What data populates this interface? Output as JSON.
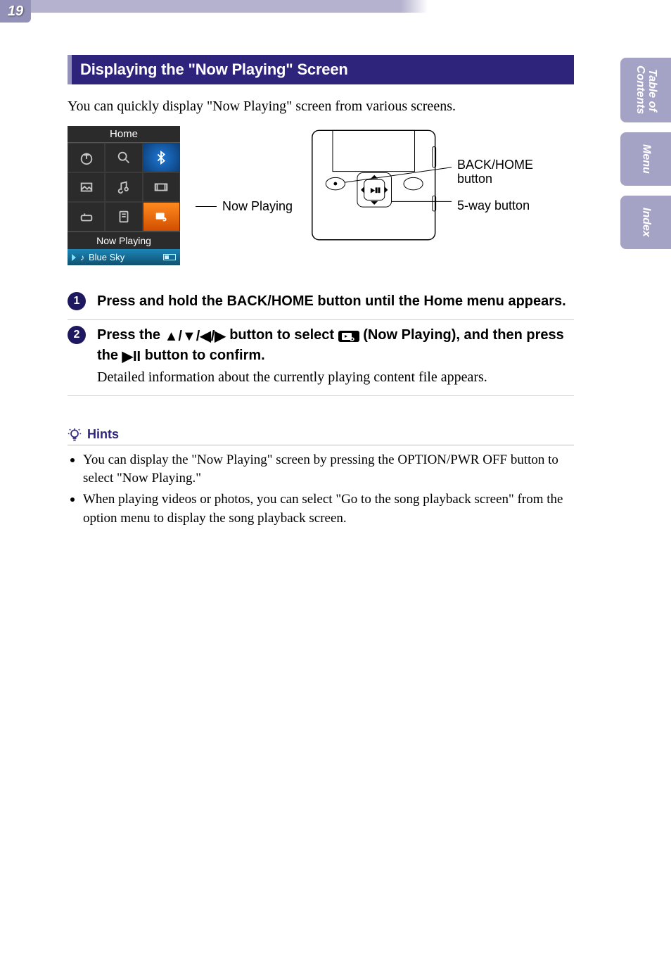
{
  "page_number": "19",
  "side_nav": {
    "toc": "Table of\nContents",
    "menu": "Menu",
    "index": "Index"
  },
  "section_title": "Displaying the \"Now Playing\" Screen",
  "intro": "You can quickly display \"Now Playing\" screen from various screens.",
  "home_screen": {
    "title": "Home",
    "selected_label": "Now Playing",
    "song_name": "Blue Sky",
    "icons": [
      "share-icon",
      "search-icon",
      "bluetooth-icon",
      "photo-icon",
      "music-icon",
      "video-icon",
      "settings-icon",
      "playlist-icon",
      "now-playing-icon"
    ]
  },
  "callouts": {
    "now_playing": "Now Playing",
    "back_home": "BACK/HOME button",
    "five_way": "5-way button"
  },
  "steps": [
    {
      "num": "1",
      "title_pre": "Press and hold the BACK/HOME button until the Home menu appears.",
      "desc": ""
    },
    {
      "num": "2",
      "title_pre": "Press the ",
      "title_mid": " button to select ",
      "title_post1": " (Now Playing), and then press the ",
      "title_post2": " button to confirm.",
      "desc": "Detailed information about the currently playing content file appears."
    }
  ],
  "arrows": "▲/▼/◀/▶",
  "play_pause": "▶II",
  "hints_label": "Hints",
  "hints": [
    "You can display the \"Now Playing\" screen by pressing the OPTION/PWR OFF button to select \"Now Playing.\"",
    "When playing videos or photos, you can select \"Go to the song playback screen\" from the option menu to display the song playback screen."
  ]
}
